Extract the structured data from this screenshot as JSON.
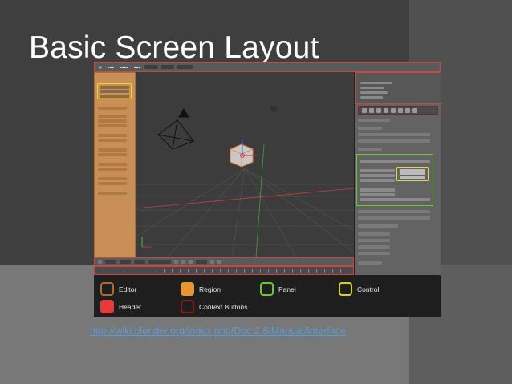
{
  "slide": {
    "title": "Basic Screen Layout",
    "link": "http://wiki.blender.org/index.php/Doc:2.6/Manual/Interface"
  },
  "legend": [
    {
      "label": "Editor",
      "color": "#b06a2e",
      "fill": "none"
    },
    {
      "label": "Region",
      "color": "#e8952e",
      "fill": "solid"
    },
    {
      "label": "Panel",
      "color": "#6cc832",
      "fill": "none"
    },
    {
      "label": "Control",
      "color": "#d8d020",
      "fill": "none"
    },
    {
      "label": "Header",
      "color": "#e83a3a",
      "fill": "solid"
    },
    {
      "label": "Context Buttons",
      "color": "#8a1e1e",
      "fill": "none"
    }
  ],
  "icons": [
    "camera-icon",
    "lamp-icon",
    "cube-icon",
    "axis-gizmo-icon"
  ]
}
